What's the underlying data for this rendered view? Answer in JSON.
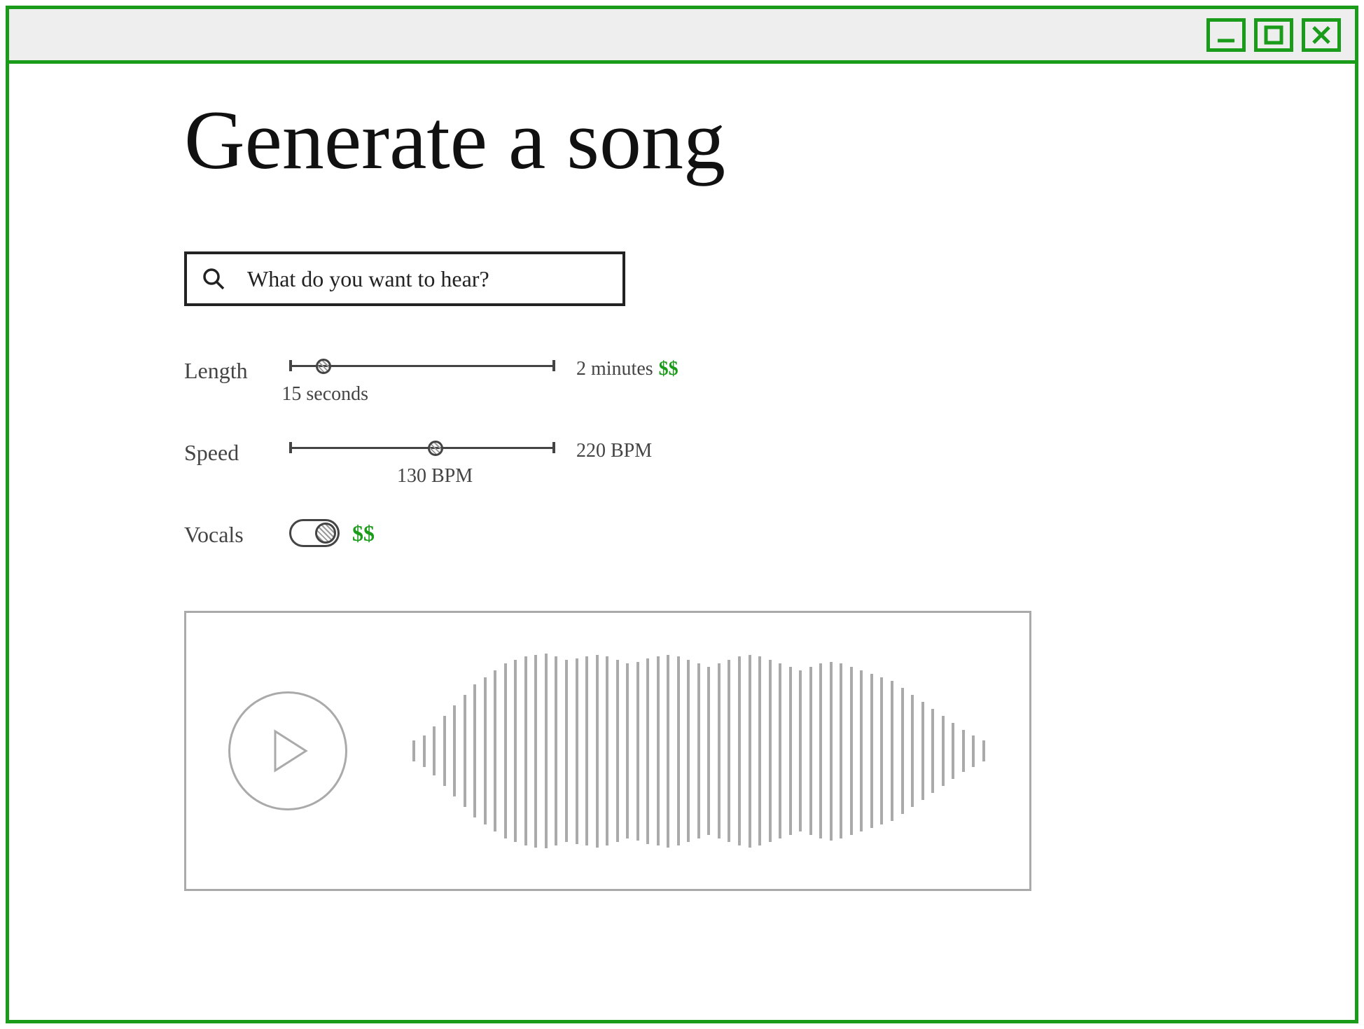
{
  "page": {
    "title": "Generate a song"
  },
  "search": {
    "placeholder": "What do you want to hear?"
  },
  "controls": {
    "length": {
      "label": "Length",
      "current": "15 seconds",
      "max": "2 minutes",
      "price": "$$",
      "handle_percent": 13
    },
    "speed": {
      "label": "Speed",
      "current": "130 BPM",
      "max": "220 BPM",
      "handle_percent": 55
    },
    "vocals": {
      "label": "Vocals",
      "price": "$$",
      "on": true
    }
  },
  "colors": {
    "accent": "#1a9c1a",
    "ink": "#222",
    "muted": "#aaa"
  }
}
